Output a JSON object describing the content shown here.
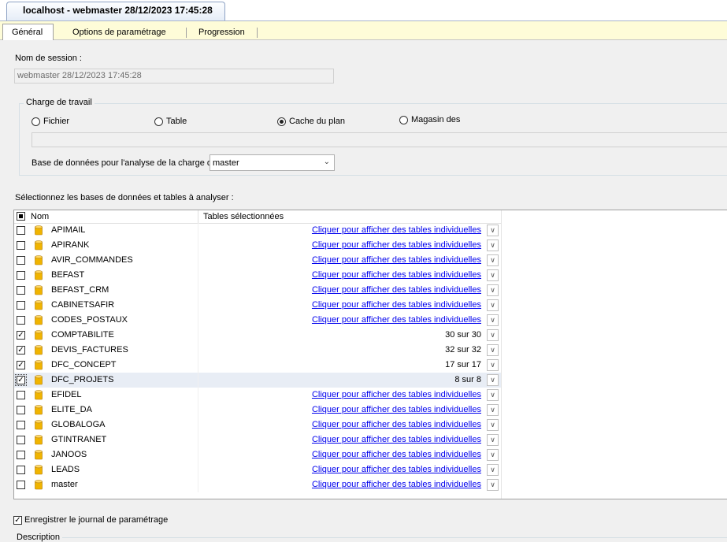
{
  "document_tab": {
    "title": "localhost - webmaster 28/12/2023 17:45:28"
  },
  "tabs": [
    {
      "label": "Général"
    },
    {
      "label": "Options de paramétrage"
    },
    {
      "label": "Progression"
    }
  ],
  "session": {
    "label": "Nom de session :",
    "value": "webmaster 28/12/2023 17:45:28"
  },
  "workload": {
    "title": "Charge de travail",
    "options": [
      {
        "label": "Fichier",
        "selected": false
      },
      {
        "label": "Table",
        "selected": false
      },
      {
        "label": "Cache du plan",
        "selected": true
      },
      {
        "label": "Magasin des",
        "selected": false
      }
    ],
    "db_label": "Base de données pour l'analyse de la charge de",
    "db_value": "master"
  },
  "databases": {
    "label": "Sélectionnez les bases de données et tables à analyser :",
    "col_name": "Nom",
    "col_tables": "Tables sélectionnées",
    "link_text": "Cliquer pour afficher des tables individuelles",
    "rows": [
      {
        "name": "APIMAIL",
        "checked": false,
        "tables": null
      },
      {
        "name": "APIRANK",
        "checked": false,
        "tables": null
      },
      {
        "name": "AVIR_COMMANDES",
        "checked": false,
        "tables": null
      },
      {
        "name": "BEFAST",
        "checked": false,
        "tables": null
      },
      {
        "name": "BEFAST_CRM",
        "checked": false,
        "tables": null
      },
      {
        "name": "CABINETSAFIR",
        "checked": false,
        "tables": null
      },
      {
        "name": "CODES_POSTAUX",
        "checked": false,
        "tables": null
      },
      {
        "name": "COMPTABILITE",
        "checked": true,
        "tables": "30 sur 30"
      },
      {
        "name": "DEVIS_FACTURES",
        "checked": true,
        "tables": "32 sur 32"
      },
      {
        "name": "DFC_CONCEPT",
        "checked": true,
        "tables": "17 sur 17"
      },
      {
        "name": "DFC_PROJETS",
        "checked": true,
        "tables": "8 sur 8",
        "selected": true
      },
      {
        "name": "EFIDEL",
        "checked": false,
        "tables": null
      },
      {
        "name": "ELITE_DA",
        "checked": false,
        "tables": null
      },
      {
        "name": "GLOBALOGA",
        "checked": false,
        "tables": null
      },
      {
        "name": "GTINTRANET",
        "checked": false,
        "tables": null
      },
      {
        "name": "JANOOS",
        "checked": false,
        "tables": null
      },
      {
        "name": "LEADS",
        "checked": false,
        "tables": null
      },
      {
        "name": "master",
        "checked": false,
        "tables": null
      }
    ]
  },
  "journal": {
    "label": "Enregistrer le journal de paramétrage",
    "checked": true
  },
  "description": {
    "title": "Description"
  },
  "colors": {
    "link": "#0000ee",
    "tab_strip": "#fefcd8",
    "db_icon": "#f0b400"
  }
}
